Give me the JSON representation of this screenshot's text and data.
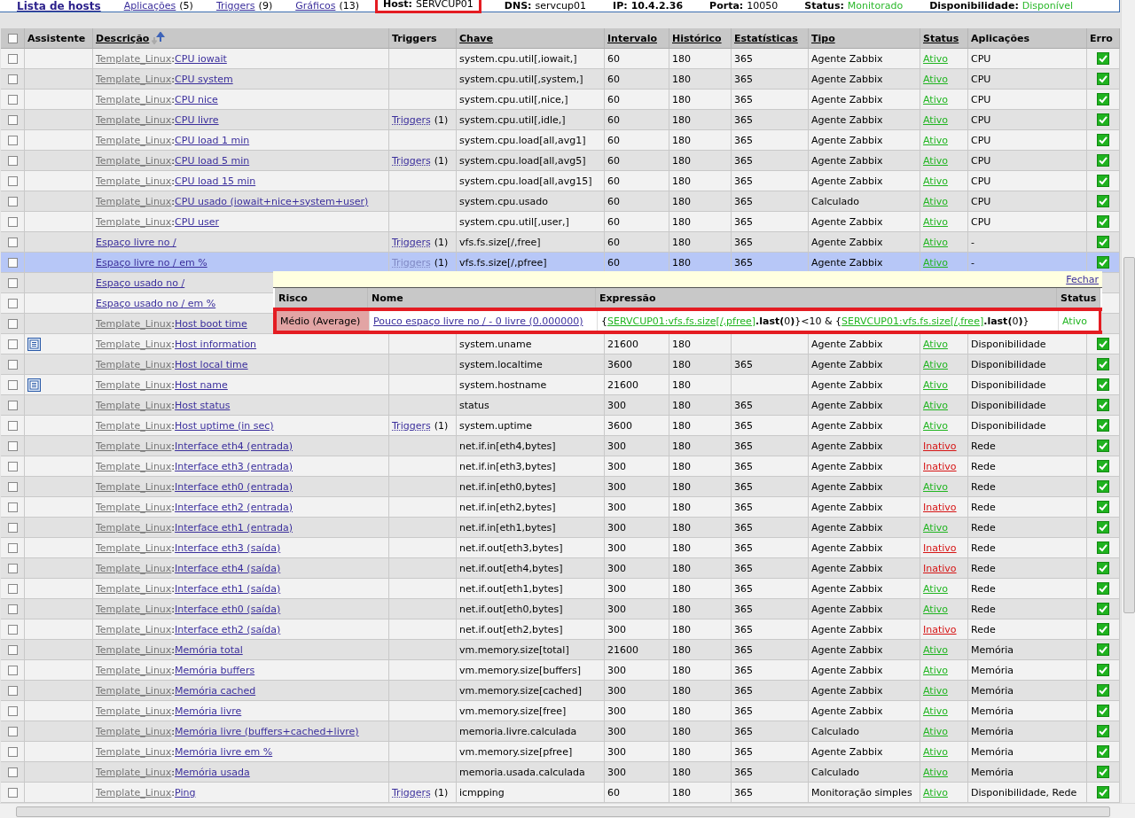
{
  "nav": [
    {
      "label": "Lista de hosts",
      "selected": true
    },
    {
      "label": "Aplicações",
      "count": "(5)",
      "selected": false
    },
    {
      "label": "Triggers",
      "count": "(9)",
      "selected": false
    },
    {
      "label": "Gráficos",
      "count": "(13)",
      "selected": false
    }
  ],
  "host_info": [
    {
      "label": "Host:",
      "value": "SERVCUP01",
      "bold": false,
      "color": "#000000",
      "framed": true
    },
    {
      "label": "DNS:",
      "value": "servcup01",
      "bold": false,
      "color": "#000000",
      "framed": false
    },
    {
      "label": "IP:",
      "value": "10.4.2.36",
      "bold": true,
      "color": "#000000",
      "framed": false
    },
    {
      "label": "Porta:",
      "value": "10050",
      "bold": false,
      "color": "#000000",
      "framed": false
    },
    {
      "label": "Status:",
      "value": "Monitorado",
      "bold": false,
      "color": "#2cb82c",
      "framed": false
    },
    {
      "label": "Disponibilidade:",
      "value": "Disponível",
      "bold": false,
      "color": "#2cb82c",
      "framed": false
    }
  ],
  "select_all": {
    "checked": false
  },
  "columns": [
    {
      "label": "Assistente",
      "sortable": false
    },
    {
      "label": "Descrição",
      "sortable": true,
      "sorted": true
    },
    {
      "label": "Triggers",
      "sortable": false
    },
    {
      "label": "Chave",
      "sortable": true
    },
    {
      "label": "Intervalo",
      "sortable": true
    },
    {
      "label": "Histórico",
      "sortable": true
    },
    {
      "label": "Estatísticas",
      "sortable": true
    },
    {
      "label": "Tipo",
      "sortable": true
    },
    {
      "label": "Status",
      "sortable": true
    },
    {
      "label": "Aplicações",
      "sortable": false
    },
    {
      "label": "Erro",
      "sortable": false
    }
  ],
  "rows": [
    {
      "checked": false,
      "selected": false,
      "template": "Template_Linux",
      "separator": ":",
      "name": "CPU iowait",
      "key": "system.cpu.util[,iowait,]",
      "interval": "60",
      "history": "180",
      "trends": "365",
      "type": "Agente Zabbix",
      "status": "Ativo",
      "active": true,
      "applications": "CPU"
    },
    {
      "checked": false,
      "selected": false,
      "template": "Template_Linux",
      "separator": ":",
      "name": "CPU system",
      "key": "system.cpu.util[,system,]",
      "interval": "60",
      "history": "180",
      "trends": "365",
      "type": "Agente Zabbix",
      "status": "Ativo",
      "active": true,
      "applications": "CPU"
    },
    {
      "checked": false,
      "selected": false,
      "template": "Template_Linux",
      "separator": ":",
      "name": "CPU nice",
      "key": "system.cpu.util[,nice,]",
      "interval": "60",
      "history": "180",
      "trends": "365",
      "type": "Agente Zabbix",
      "status": "Ativo",
      "active": true,
      "applications": "CPU"
    },
    {
      "checked": false,
      "selected": false,
      "template": "Template_Linux",
      "separator": ":",
      "name": "CPU livre",
      "triggers": "Triggers",
      "trigger_count": "(1)",
      "key": "system.cpu.util[,idle,]",
      "interval": "60",
      "history": "180",
      "trends": "365",
      "type": "Agente Zabbix",
      "status": "Ativo",
      "active": true,
      "applications": "CPU"
    },
    {
      "checked": false,
      "selected": false,
      "template": "Template_Linux",
      "separator": ":",
      "name": "CPU load 1 min",
      "key": "system.cpu.load[all,avg1]",
      "interval": "60",
      "history": "180",
      "trends": "365",
      "type": "Agente Zabbix",
      "status": "Ativo",
      "active": true,
      "applications": "CPU"
    },
    {
      "checked": false,
      "selected": false,
      "template": "Template_Linux",
      "separator": ":",
      "name": "CPU load 5 min",
      "triggers": "Triggers",
      "trigger_count": "(1)",
      "key": "system.cpu.load[all,avg5]",
      "interval": "60",
      "history": "180",
      "trends": "365",
      "type": "Agente Zabbix",
      "status": "Ativo",
      "active": true,
      "applications": "CPU"
    },
    {
      "checked": false,
      "selected": false,
      "template": "Template_Linux",
      "separator": ":",
      "name": "CPU load 15 min",
      "key": "system.cpu.load[all,avg15]",
      "interval": "60",
      "history": "180",
      "trends": "365",
      "type": "Agente Zabbix",
      "status": "Ativo",
      "active": true,
      "applications": "CPU"
    },
    {
      "checked": false,
      "selected": false,
      "template": "Template_Linux",
      "separator": ":",
      "name": "CPU usado (iowait+nice+system+user)",
      "key": "system.cpu.usado",
      "interval": "60",
      "history": "180",
      "trends": "365",
      "type": "Calculado",
      "status": "Ativo",
      "active": true,
      "applications": "CPU"
    },
    {
      "checked": false,
      "selected": false,
      "template": "Template_Linux",
      "separator": ":",
      "name": "CPU user",
      "key": "system.cpu.util[,user,]",
      "interval": "60",
      "history": "180",
      "trends": "365",
      "type": "Agente Zabbix",
      "status": "Ativo",
      "active": true,
      "applications": "CPU"
    },
    {
      "checked": false,
      "selected": false,
      "name": "Espaço livre no /",
      "triggers": "Triggers",
      "trigger_count": "(1)",
      "key": "vfs.fs.size[/,free]",
      "interval": "60",
      "history": "180",
      "trends": "365",
      "type": "Agente Zabbix",
      "status": "Ativo",
      "active": true,
      "applications": "-"
    },
    {
      "checked": false,
      "selected": true,
      "name": "Espaço livre no / em %",
      "triggers": "Triggers",
      "trigger_count": "(1)",
      "key": "vfs.fs.size[/,pfree]",
      "interval": "60",
      "history": "180",
      "trends": "365",
      "type": "Agente Zabbix",
      "status": "Ativo",
      "active": true,
      "applications": "-"
    },
    {
      "checked": false,
      "selected": false,
      "name": "Espaço usado no /"
    },
    {
      "checked": false,
      "selected": false,
      "name": "Espaço usado no / em %"
    },
    {
      "checked": false,
      "selected": false,
      "template": "Template_Linux",
      "separator": ":",
      "name": "Host boot time"
    },
    {
      "checked": false,
      "selected": false,
      "wizard": true,
      "template": "Template_Linux",
      "separator": ":",
      "name": "Host information",
      "key": "system.uname",
      "interval": "21600",
      "history": "180",
      "type": "Agente Zabbix",
      "status": "Ativo",
      "active": true,
      "applications": "Disponibilidade"
    },
    {
      "checked": false,
      "selected": false,
      "template": "Template_Linux",
      "separator": ":",
      "name": "Host local time",
      "key": "system.localtime",
      "interval": "3600",
      "history": "180",
      "trends": "365",
      "type": "Agente Zabbix",
      "status": "Ativo",
      "active": true,
      "applications": "Disponibilidade"
    },
    {
      "checked": false,
      "selected": false,
      "wizard": true,
      "template": "Template_Linux",
      "separator": ":",
      "name": "Host name",
      "key": "system.hostname",
      "interval": "21600",
      "history": "180",
      "type": "Agente Zabbix",
      "status": "Ativo",
      "active": true,
      "applications": "Disponibilidade"
    },
    {
      "checked": false,
      "selected": false,
      "template": "Template_Linux",
      "separator": ":",
      "name": "Host status",
      "key": "status",
      "interval": "300",
      "history": "180",
      "trends": "365",
      "type": "Agente Zabbix",
      "status": "Ativo",
      "active": true,
      "applications": "Disponibilidade"
    },
    {
      "checked": false,
      "selected": false,
      "template": "Template_Linux",
      "separator": ":",
      "name": "Host uptime (in sec)",
      "triggers": "Triggers",
      "trigger_count": "(1)",
      "key": "system.uptime",
      "interval": "3600",
      "history": "180",
      "trends": "365",
      "type": "Agente Zabbix",
      "status": "Ativo",
      "active": true,
      "applications": "Disponibilidade"
    },
    {
      "checked": false,
      "selected": false,
      "template": "Template_Linux",
      "separator": ":",
      "name": "Interface eth4 (entrada)",
      "key": "net.if.in[eth4,bytes]",
      "interval": "300",
      "history": "180",
      "trends": "365",
      "type": "Agente Zabbix",
      "status": "Inativo",
      "active": false,
      "applications": "Rede"
    },
    {
      "checked": false,
      "selected": false,
      "template": "Template_Linux",
      "separator": ":",
      "name": "Interface eth3 (entrada)",
      "key": "net.if.in[eth3,bytes]",
      "interval": "300",
      "history": "180",
      "trends": "365",
      "type": "Agente Zabbix",
      "status": "Inativo",
      "active": false,
      "applications": "Rede"
    },
    {
      "checked": false,
      "selected": false,
      "template": "Template_Linux",
      "separator": ":",
      "name": "Interface eth0 (entrada)",
      "key": "net.if.in[eth0,bytes]",
      "interval": "300",
      "history": "180",
      "trends": "365",
      "type": "Agente Zabbix",
      "status": "Ativo",
      "active": true,
      "applications": "Rede"
    },
    {
      "checked": false,
      "selected": false,
      "template": "Template_Linux",
      "separator": ":",
      "name": "Interface eth2 (entrada)",
      "key": "net.if.in[eth2,bytes]",
      "interval": "300",
      "history": "180",
      "trends": "365",
      "type": "Agente Zabbix",
      "status": "Inativo",
      "active": false,
      "applications": "Rede"
    },
    {
      "checked": false,
      "selected": false,
      "template": "Template_Linux",
      "separator": ":",
      "name": "Interface eth1 (entrada)",
      "key": "net.if.in[eth1,bytes]",
      "interval": "300",
      "history": "180",
      "trends": "365",
      "type": "Agente Zabbix",
      "status": "Ativo",
      "active": true,
      "applications": "Rede"
    },
    {
      "checked": false,
      "selected": false,
      "template": "Template_Linux",
      "separator": ":",
      "name": "Interface eth3 (saída)",
      "key": "net.if.out[eth3,bytes]",
      "interval": "300",
      "history": "180",
      "trends": "365",
      "type": "Agente Zabbix",
      "status": "Inativo",
      "active": false,
      "applications": "Rede"
    },
    {
      "checked": false,
      "selected": false,
      "template": "Template_Linux",
      "separator": ":",
      "name": "Interface eth4 (saída)",
      "key": "net.if.out[eth4,bytes]",
      "interval": "300",
      "history": "180",
      "trends": "365",
      "type": "Agente Zabbix",
      "status": "Inativo",
      "active": false,
      "applications": "Rede"
    },
    {
      "checked": false,
      "selected": false,
      "template": "Template_Linux",
      "separator": ":",
      "name": "Interface eth1 (saída)",
      "key": "net.if.out[eth1,bytes]",
      "interval": "300",
      "history": "180",
      "trends": "365",
      "type": "Agente Zabbix",
      "status": "Ativo",
      "active": true,
      "applications": "Rede"
    },
    {
      "checked": false,
      "selected": false,
      "template": "Template_Linux",
      "separator": ":",
      "name": "Interface eth0 (saída)",
      "key": "net.if.out[eth0,bytes]",
      "interval": "300",
      "history": "180",
      "trends": "365",
      "type": "Agente Zabbix",
      "status": "Ativo",
      "active": true,
      "applications": "Rede"
    },
    {
      "checked": false,
      "selected": false,
      "template": "Template_Linux",
      "separator": ":",
      "name": "Interface eth2 (saída)",
      "key": "net.if.out[eth2,bytes]",
      "interval": "300",
      "history": "180",
      "trends": "365",
      "type": "Agente Zabbix",
      "status": "Inativo",
      "active": false,
      "applications": "Rede"
    },
    {
      "checked": false,
      "selected": false,
      "template": "Template_Linux",
      "separator": ":",
      "name": "Memória total",
      "key": "vm.memory.size[total]",
      "interval": "21600",
      "history": "180",
      "trends": "365",
      "type": "Agente Zabbix",
      "status": "Ativo",
      "active": true,
      "applications": "Memória"
    },
    {
      "checked": false,
      "selected": false,
      "template": "Template_Linux",
      "separator": ":",
      "name": "Memória buffers",
      "key": "vm.memory.size[buffers]",
      "interval": "300",
      "history": "180",
      "trends": "365",
      "type": "Agente Zabbix",
      "status": "Ativo",
      "active": true,
      "applications": "Memória"
    },
    {
      "checked": false,
      "selected": false,
      "template": "Template_Linux",
      "separator": ":",
      "name": "Memória cached",
      "key": "vm.memory.size[cached]",
      "interval": "300",
      "history": "180",
      "trends": "365",
      "type": "Agente Zabbix",
      "status": "Ativo",
      "active": true,
      "applications": "Memória"
    },
    {
      "checked": false,
      "selected": false,
      "template": "Template_Linux",
      "separator": ":",
      "name": "Memória livre",
      "key": "vm.memory.size[free]",
      "interval": "300",
      "history": "180",
      "trends": "365",
      "type": "Agente Zabbix",
      "status": "Ativo",
      "active": true,
      "applications": "Memória"
    },
    {
      "checked": false,
      "selected": false,
      "template": "Template_Linux",
      "separator": ":",
      "name": "Memória livre (buffers+cached+livre)",
      "key": "memoria.livre.calculada",
      "interval": "300",
      "history": "180",
      "trends": "365",
      "type": "Calculado",
      "status": "Ativo",
      "active": true,
      "applications": "Memória"
    },
    {
      "checked": false,
      "selected": false,
      "template": "Template_Linux",
      "separator": ":",
      "name": "Memória livre em %",
      "key": "vm.memory.size[pfree]",
      "interval": "300",
      "history": "180",
      "trends": "365",
      "type": "Agente Zabbix",
      "status": "Ativo",
      "active": true,
      "applications": "Memória"
    },
    {
      "checked": false,
      "selected": false,
      "template": "Template_Linux",
      "separator": ":",
      "name": "Memória usada",
      "key": "memoria.usada.calculada",
      "interval": "300",
      "history": "180",
      "trends": "365",
      "type": "Calculado",
      "status": "Ativo",
      "active": true,
      "applications": "Memória"
    },
    {
      "checked": false,
      "selected": false,
      "template": "Template_Linux",
      "separator": ":",
      "name": "Ping",
      "triggers": "Triggers",
      "trigger_count": "(1)",
      "key": "icmpping",
      "interval": "60",
      "history": "180",
      "trends": "365",
      "type": "Monitoração simples",
      "status": "Ativo",
      "active": true,
      "applications": "Disponibilidade, Rede"
    }
  ],
  "trigger_popup": {
    "close": "Fechar",
    "columns": [
      "Risco",
      "Nome",
      "Expressão",
      "Status"
    ],
    "rows": [
      {
        "color": "#e2a4a4",
        "risk": "Médio (Average)",
        "name": "Pouco espaço livre no / - 0 livre (0.000000)",
        "expression": [
          {
            "kind": "text",
            "text": "{"
          },
          {
            "kind": "link",
            "text": "SERVCUP01:vfs.fs.size[/,pfree]"
          },
          {
            "kind": "bold",
            "text": ".last("
          },
          {
            "kind": "text",
            "text": "0"
          },
          {
            "kind": "bold",
            "text": ")"
          },
          {
            "kind": "text",
            "text": "}<10 & {"
          },
          {
            "kind": "link",
            "text": "SERVCUP01:vfs.fs.size[/,free]"
          },
          {
            "kind": "bold",
            "text": ".last("
          },
          {
            "kind": "text",
            "text": "0"
          },
          {
            "kind": "bold",
            "text": ")"
          },
          {
            "kind": "text",
            "text": "}"
          }
        ],
        "status": "Ativo",
        "active": true,
        "framed": true
      }
    ]
  }
}
